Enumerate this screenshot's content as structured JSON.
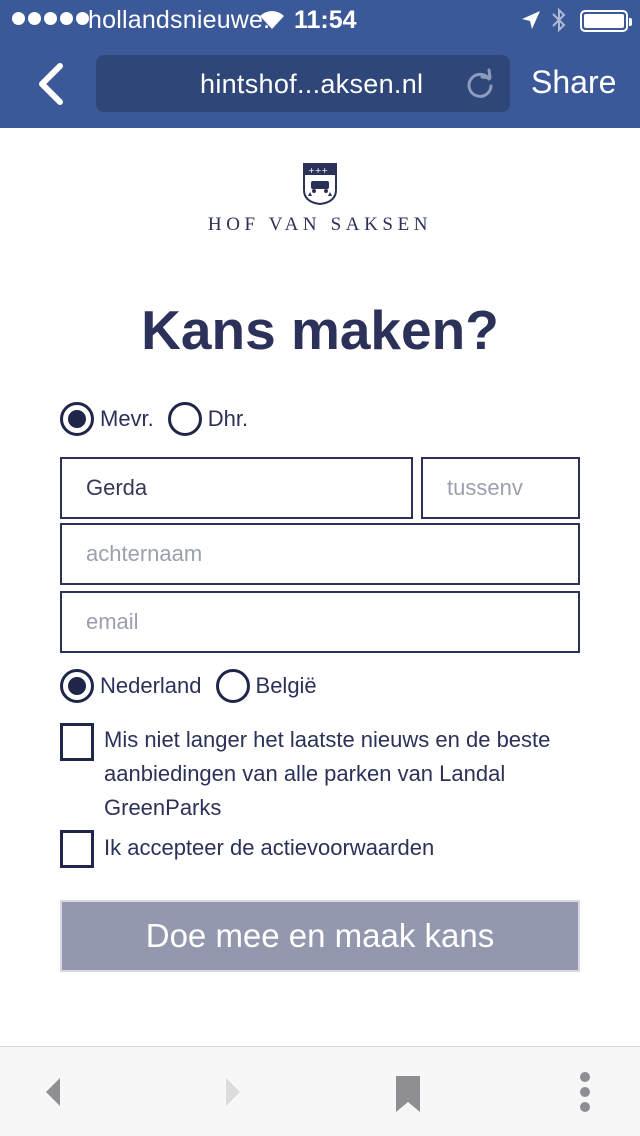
{
  "status_bar": {
    "carrier": "hollandsnieuwe.",
    "time": "11:54"
  },
  "browser": {
    "url": "hintshof...aksen.nl",
    "share_label": "Share"
  },
  "brand": {
    "name": "HOF VAN SAKSEN"
  },
  "form": {
    "heading": "Kans maken?",
    "salutation": {
      "options": [
        "Mevr.",
        "Dhr."
      ],
      "selected": "Mevr."
    },
    "first_name": {
      "value": "Gerda",
      "placeholder": ""
    },
    "tussenvoegsel": {
      "value": "",
      "placeholder": "tussenv"
    },
    "last_name": {
      "value": "",
      "placeholder": "achternaam"
    },
    "email": {
      "value": "",
      "placeholder": "email"
    },
    "country": {
      "options": [
        "Nederland",
        "België"
      ],
      "selected": "Nederland"
    },
    "newsletter_label": "Mis niet langer het laatste nieuws en de beste aanbiedingen van alle parken van Landal GreenParks",
    "terms_label": "Ik accepteer de actievoorwaarden",
    "submit_label": "Doe mee en maak kans"
  },
  "icons": [
    "back-chevron-icon",
    "reload-icon",
    "wifi-icon",
    "location-arrow-icon",
    "bluetooth-icon",
    "battery-icon",
    "crest-icon",
    "back-arrow-icon",
    "forward-arrow-icon",
    "bookmark-icon",
    "more-dots-icon"
  ],
  "colors": {
    "header_blue": "#3b5998",
    "url_box": "#2e4778",
    "navy_text": "#2b3158",
    "button_gray": "#9498ae"
  }
}
